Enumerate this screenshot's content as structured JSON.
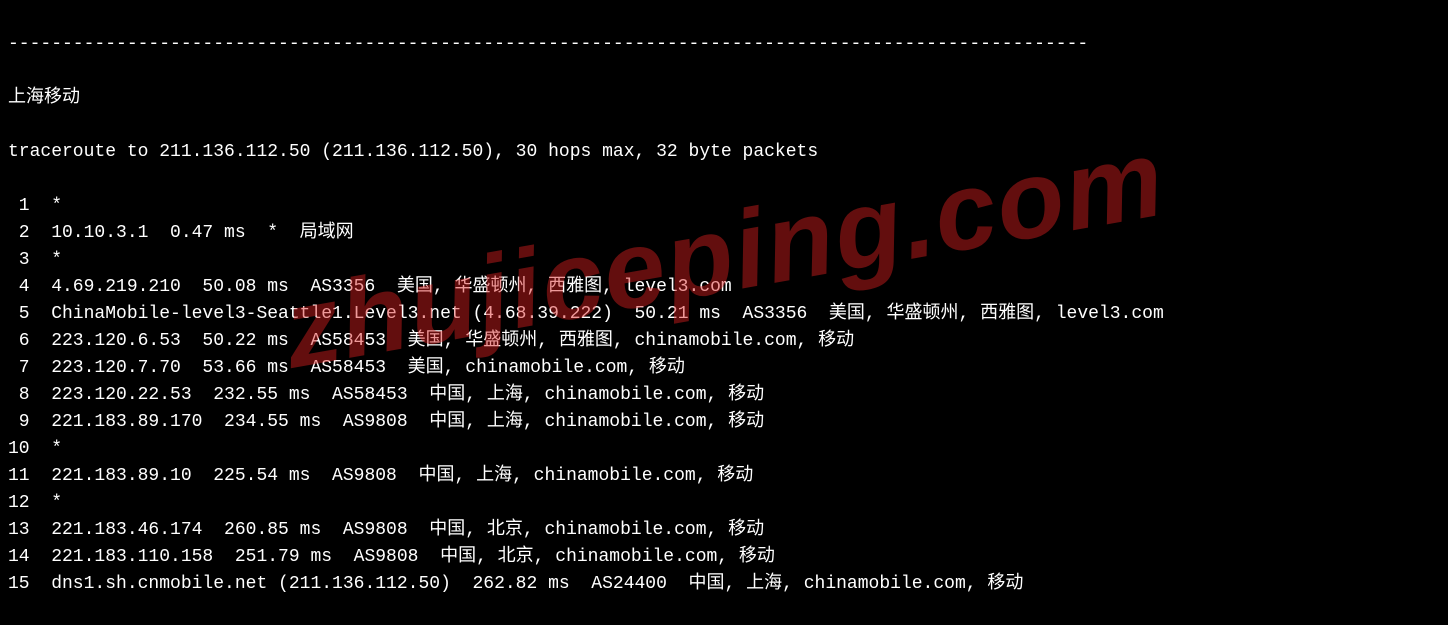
{
  "divider": "----------------------------------------------------------------------------------------------------",
  "title": "上海移动",
  "header": "traceroute to 211.136.112.50 (211.136.112.50), 30 hops max, 32 byte packets",
  "watermark": "zhujiceping.com",
  "hops": [
    {
      "num": "1",
      "rest": "*"
    },
    {
      "num": "2",
      "rest": "10.10.3.1  0.47 ms  *  局域网"
    },
    {
      "num": "3",
      "rest": "*"
    },
    {
      "num": "4",
      "rest": "4.69.219.210  50.08 ms  AS3356  美国, 华盛顿州, 西雅图, level3.com"
    },
    {
      "num": "5",
      "rest": "ChinaMobile-level3-Seattle1.Level3.net (4.68.39.222)  50.21 ms  AS3356  美国, 华盛顿州, 西雅图, level3.com"
    },
    {
      "num": "6",
      "rest": "223.120.6.53  50.22 ms  AS58453  美国, 华盛顿州, 西雅图, chinamobile.com, 移动"
    },
    {
      "num": "7",
      "rest": "223.120.7.70  53.66 ms  AS58453  美国, chinamobile.com, 移动"
    },
    {
      "num": "8",
      "rest": "223.120.22.53  232.55 ms  AS58453  中国, 上海, chinamobile.com, 移动"
    },
    {
      "num": "9",
      "rest": "221.183.89.170  234.55 ms  AS9808  中国, 上海, chinamobile.com, 移动"
    },
    {
      "num": "10",
      "rest": "*"
    },
    {
      "num": "11",
      "rest": "221.183.89.10  225.54 ms  AS9808  中国, 上海, chinamobile.com, 移动"
    },
    {
      "num": "12",
      "rest": "*"
    },
    {
      "num": "13",
      "rest": "221.183.46.174  260.85 ms  AS9808  中国, 北京, chinamobile.com, 移动"
    },
    {
      "num": "14",
      "rest": "221.183.110.158  251.79 ms  AS9808  中国, 北京, chinamobile.com, 移动"
    },
    {
      "num": "15",
      "rest": "dns1.sh.cnmobile.net (211.136.112.50)  262.82 ms  AS24400  中国, 上海, chinamobile.com, 移动"
    }
  ]
}
